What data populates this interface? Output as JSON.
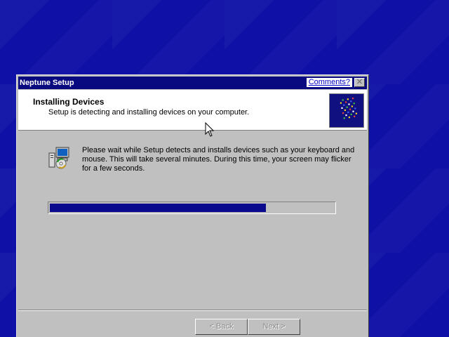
{
  "window": {
    "title": "Neptune Setup",
    "comments_link": "Comments?",
    "close_glyph": "✕"
  },
  "header": {
    "title": "Installing Devices",
    "subtitle": "Setup is detecting and installing devices on your computer.",
    "logo_icon": "windows-flag-logo-icon"
  },
  "body": {
    "icon": "computer-cd-icon",
    "message": "Please wait while Setup detects and installs devices such as your keyboard and mouse.  This will take several minutes.  During this time, your screen may flicker for a few seconds.",
    "progress_fraction": 0.76
  },
  "buttons": {
    "back_label": "< Back",
    "next_label": "Next >"
  },
  "colors": {
    "desktop": "#0e10a6",
    "titlebar": "#0a0a80",
    "progress": "#0a0a8c",
    "dialog": "#c0c0c0"
  }
}
